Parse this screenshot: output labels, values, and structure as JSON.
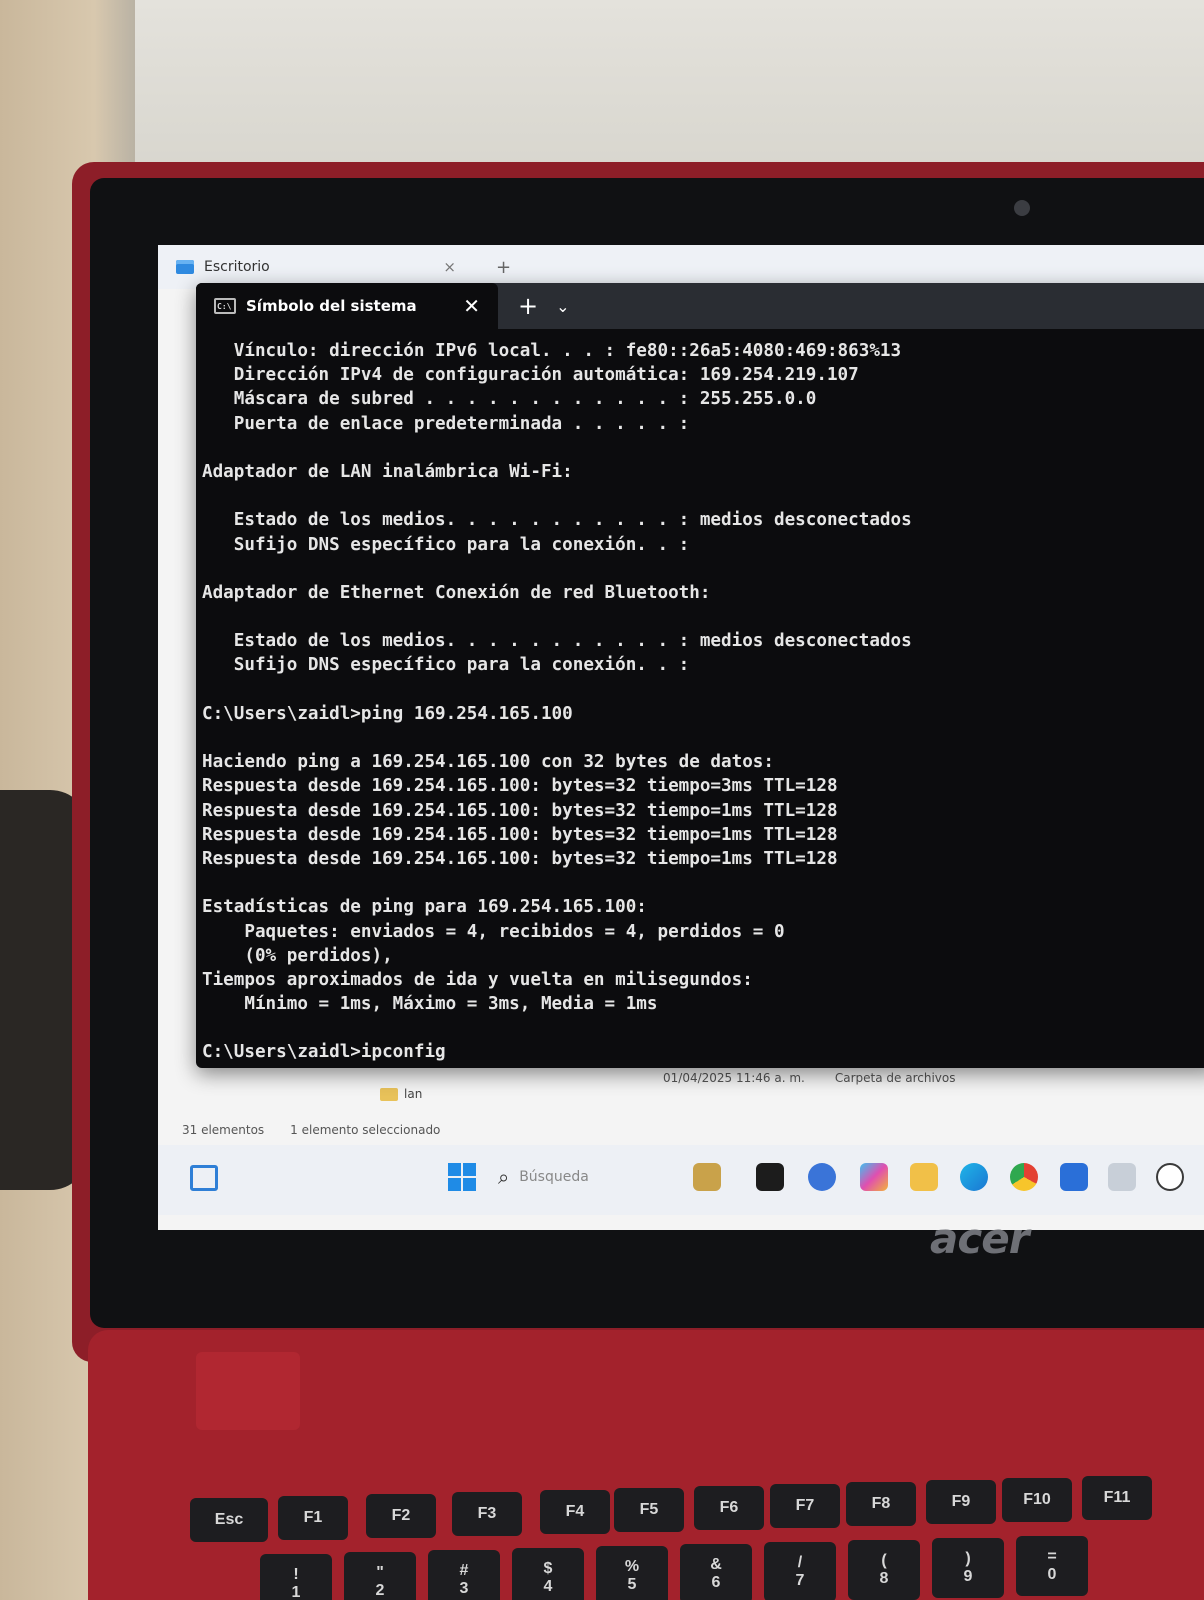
{
  "device": {
    "brand_logo": "acer"
  },
  "explorer": {
    "tab_title": "Escritorio",
    "tab_close": "×",
    "new_tab": "+",
    "selected_item": {
      "name": "lan",
      "date": "01/04/2025 11:46 a. m.",
      "type": "Carpeta de archivos"
    },
    "status": {
      "count": "31 elementos",
      "selection": "1 elemento seleccionado"
    }
  },
  "terminal": {
    "tab_title": "Símbolo del sistema",
    "tab_close": "✕",
    "new_tab": "+",
    "dropdown": "⌄",
    "lines": [
      "   Vínculo: dirección IPv6 local. . . : fe80::26a5:4080:469:863%13",
      "   Dirección IPv4 de configuración automática: 169.254.219.107",
      "   Máscara de subred . . . . . . . . . . . . : 255.255.0.0",
      "   Puerta de enlace predeterminada . . . . . :",
      "",
      "Adaptador de LAN inalámbrica Wi-Fi:",
      "",
      "   Estado de los medios. . . . . . . . . . . : medios desconectados",
      "   Sufijo DNS específico para la conexión. . :",
      "",
      "Adaptador de Ethernet Conexión de red Bluetooth:",
      "",
      "   Estado de los medios. . . . . . . . . . . : medios desconectados",
      "   Sufijo DNS específico para la conexión. . :",
      "",
      "C:\\Users\\zaidl>ping 169.254.165.100",
      "",
      "Haciendo ping a 169.254.165.100 con 32 bytes de datos:",
      "Respuesta desde 169.254.165.100: bytes=32 tiempo=3ms TTL=128",
      "Respuesta desde 169.254.165.100: bytes=32 tiempo=1ms TTL=128",
      "Respuesta desde 169.254.165.100: bytes=32 tiempo=1ms TTL=128",
      "Respuesta desde 169.254.165.100: bytes=32 tiempo=1ms TTL=128",
      "",
      "Estadísticas de ping para 169.254.165.100:",
      "    Paquetes: enviados = 4, recibidos = 4, perdidos = 0",
      "    (0% perdidos),",
      "Tiempos aproximados de ida y vuelta en milisegundos:",
      "    Mínimo = 1ms, Máximo = 3ms, Media = 1ms",
      "",
      "C:\\Users\\zaidl>ipconfig"
    ]
  },
  "taskbar": {
    "search_placeholder": "Búsqueda",
    "search_icon": "search-icon",
    "pinned_icons": [
      "widgets-icon",
      "start-icon",
      "app-icon",
      "terminal-icon",
      "chat-icon",
      "copilot-icon",
      "file-explorer-icon",
      "edge-icon",
      "chrome-icon",
      "store-icon",
      "app-icon",
      "whatsapp-icon"
    ]
  },
  "keyboard": {
    "row_function": [
      "Esc",
      "F1",
      "F2",
      "F3",
      "F4",
      "F5",
      "F6",
      "F7",
      "F8",
      "F9",
      "F10",
      "F11"
    ],
    "row_numbers": [
      "!",
      "\"",
      "#",
      "$",
      "%",
      "&",
      "/",
      "(",
      ")",
      "="
    ],
    "row_numbers_secondary": [
      "1",
      "2",
      "3",
      "4",
      "5",
      "6",
      "7",
      "8",
      "9",
      "0"
    ]
  }
}
